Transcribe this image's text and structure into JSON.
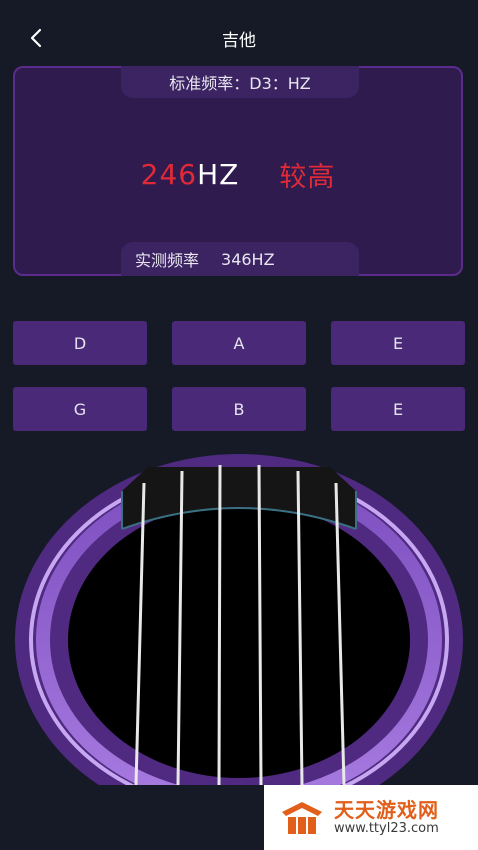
{
  "header": {
    "title": "吉他",
    "back_icon": "chevron-left-icon"
  },
  "tuner": {
    "standard_label": "标准频率：",
    "standard_value": "D3：HZ",
    "frequency_value": "246",
    "frequency_unit": "HZ",
    "status": "较高",
    "measured_label": "实测频率",
    "measured_value": "346HZ"
  },
  "strings": [
    "D",
    "A",
    "E",
    "G",
    "B",
    "E"
  ],
  "colors": {
    "background": "#161a27",
    "panel": "#2f1b4d",
    "button": "#4a2a78",
    "accent_red": "#e02a38",
    "watermark_orange": "#e15f1a"
  },
  "watermark": {
    "name": "天天游戏网",
    "url": "www.ttyl23.com"
  }
}
